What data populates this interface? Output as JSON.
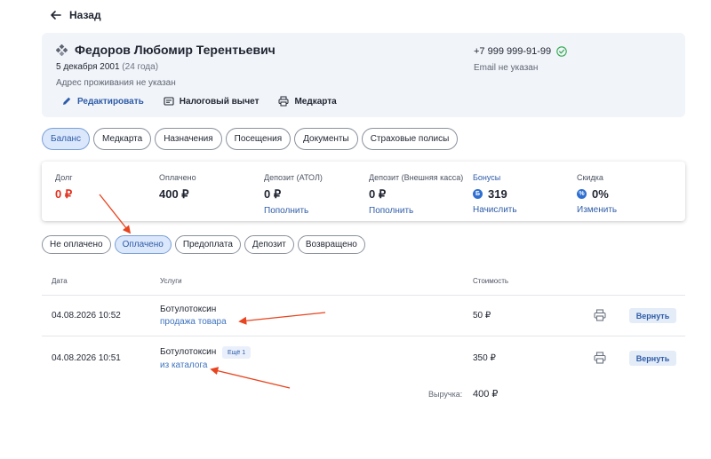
{
  "nav": {
    "back_label": "Назад"
  },
  "patient": {
    "name": "Федоров Любомир Терентьевич",
    "birth_date": "5 декабря 2001",
    "age": "(24 года)",
    "address": "Адрес проживания не указан",
    "phone": "+7 999 999-91-99",
    "email": "Email не указан"
  },
  "actions": {
    "edit": "Редактировать",
    "tax": "Налоговый вычет",
    "medcard": "Медкарта"
  },
  "tabs": [
    "Баланс",
    "Медкарта",
    "Назначения",
    "Посещения",
    "Документы",
    "Страховые полисы"
  ],
  "balance": {
    "debt": {
      "label": "Долг",
      "value": "0 ₽"
    },
    "paid": {
      "label": "Оплачено",
      "value": "400 ₽"
    },
    "deposit_atol": {
      "label": "Депозит (АТОЛ)",
      "value": "0 ₽",
      "link": "Пополнить"
    },
    "deposit_ext": {
      "label": "Депозит (Внешняя касса)",
      "value": "0 ₽",
      "link": "Пополнить"
    },
    "bonus": {
      "label": "Бонусы",
      "badge": "Б",
      "value": "319",
      "link": "Начислить"
    },
    "discount": {
      "label": "Скидка",
      "badge": "%",
      "value": "0%",
      "link": "Изменить"
    }
  },
  "filters": [
    "Не оплачено",
    "Оплачено",
    "Предоплата",
    "Депозит",
    "Возвращено"
  ],
  "table": {
    "headers": {
      "date": "Дата",
      "services": "Услуги",
      "cost": "Стоимость"
    },
    "rows": [
      {
        "date": "04.08.2026 10:52",
        "service": "Ботулотоксин",
        "source": "продажа товара",
        "cost": "50 ₽",
        "return": "Вернуть"
      },
      {
        "date": "04.08.2026 10:51",
        "service": "Ботулотоксин",
        "more": "Ещё 1",
        "source": "из каталога",
        "cost": "350 ₽",
        "return": "Вернуть"
      }
    ],
    "total_label": "Выручка:",
    "total_value": "400 ₽"
  },
  "colors": {
    "accent": "#2e5ca8",
    "debt": "#e0301e",
    "annotation_arrow": "#e8441f"
  }
}
